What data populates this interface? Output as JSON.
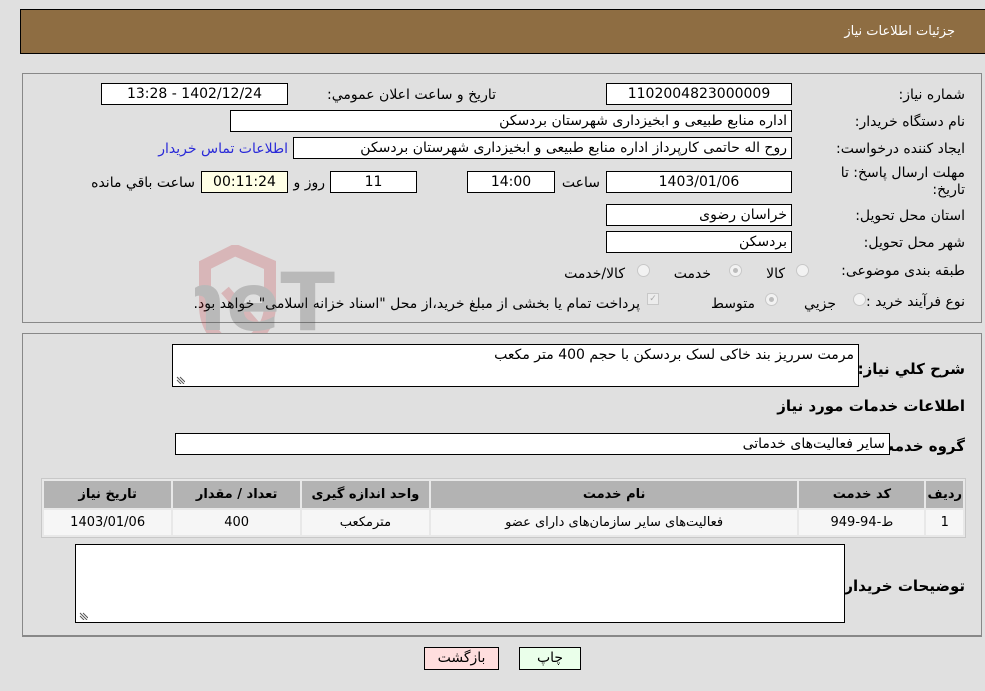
{
  "header": {
    "title": "جزئیات اطلاعات نیاز"
  },
  "form": {
    "need_number_label": "شماره نیاز:",
    "need_number": "1102004823000009",
    "announce_label": "تاریخ و ساعت اعلان عمومي:",
    "announce_value": "1402/12/24 - 13:28",
    "buyer_org_label": "نام دستگاه خریدار:",
    "buyer_org": "اداره منابع طبیعی و ابخیزداری شهرستان بردسکن",
    "creator_label": "ایجاد کننده درخواست:",
    "creator": "روح اله حاتمی کارپرداز اداره منابع طبیعی و ابخیزداری شهرستان بردسکن",
    "contact_link": "اطلاعات تماس خریدار",
    "deadline_label": "مهلت ارسال پاسخ: تا تاریخ:",
    "deadline_date": "1403/01/06",
    "time_label": "ساعت",
    "deadline_time": "14:00",
    "days_value": "11",
    "days_label": "روز و",
    "remaining_time": "00:11:24",
    "remaining_label": "ساعت باقي مانده",
    "province_label": "استان محل تحویل:",
    "province": "خراسان رضوی",
    "city_label": "شهر محل تحویل:",
    "city": "بردسکن",
    "category_label": "طبقه بندی موضوعی:",
    "category_options": [
      "کالا",
      "خدمت",
      "کالا/خدمت"
    ],
    "category_selected": "خدمت",
    "process_label": "نوع فرآیند خرید :",
    "process_options": [
      "جزیي",
      "متوسط"
    ],
    "process_selected": "متوسط",
    "treasury_note": "پرداخت تمام یا بخشی از مبلغ خرید،از محل \"اسناد خزانه اسلامی\" خواهد بود."
  },
  "details": {
    "description_label": "شرح کلي نیاز:",
    "description": "مرمت سرریز بند خاکی لسک بردسکن با حجم 400 متر مکعب",
    "services_heading": "اطلاعات خدمات مورد نیاز",
    "service_group_label": "گروه خدمت:",
    "service_group": "سایر فعالیت‌های خدماتی",
    "table": {
      "headers": [
        "ردیف",
        "کد خدمت",
        "نام خدمت",
        "واحد اندازه گیری",
        "تعداد / مقدار",
        "تاریخ نیاز"
      ],
      "rows": [
        [
          "1",
          "ط-94-949",
          "فعالیت‌های سایر سازمان‌های دارای عضو",
          "مترمکعب",
          "400",
          "1403/01/06"
        ]
      ]
    },
    "buyer_notes_label": "توضیحات خریدار:",
    "buyer_notes": ""
  },
  "buttons": {
    "print": "چاپ",
    "back": "بازگشت"
  },
  "watermark": {
    "text": "AriaTender.neT"
  },
  "colors": {
    "header_bg": "#8e6d42",
    "print_bg": "#eaffea",
    "back_bg": "#ffdede",
    "link": "#2a2ad8"
  }
}
